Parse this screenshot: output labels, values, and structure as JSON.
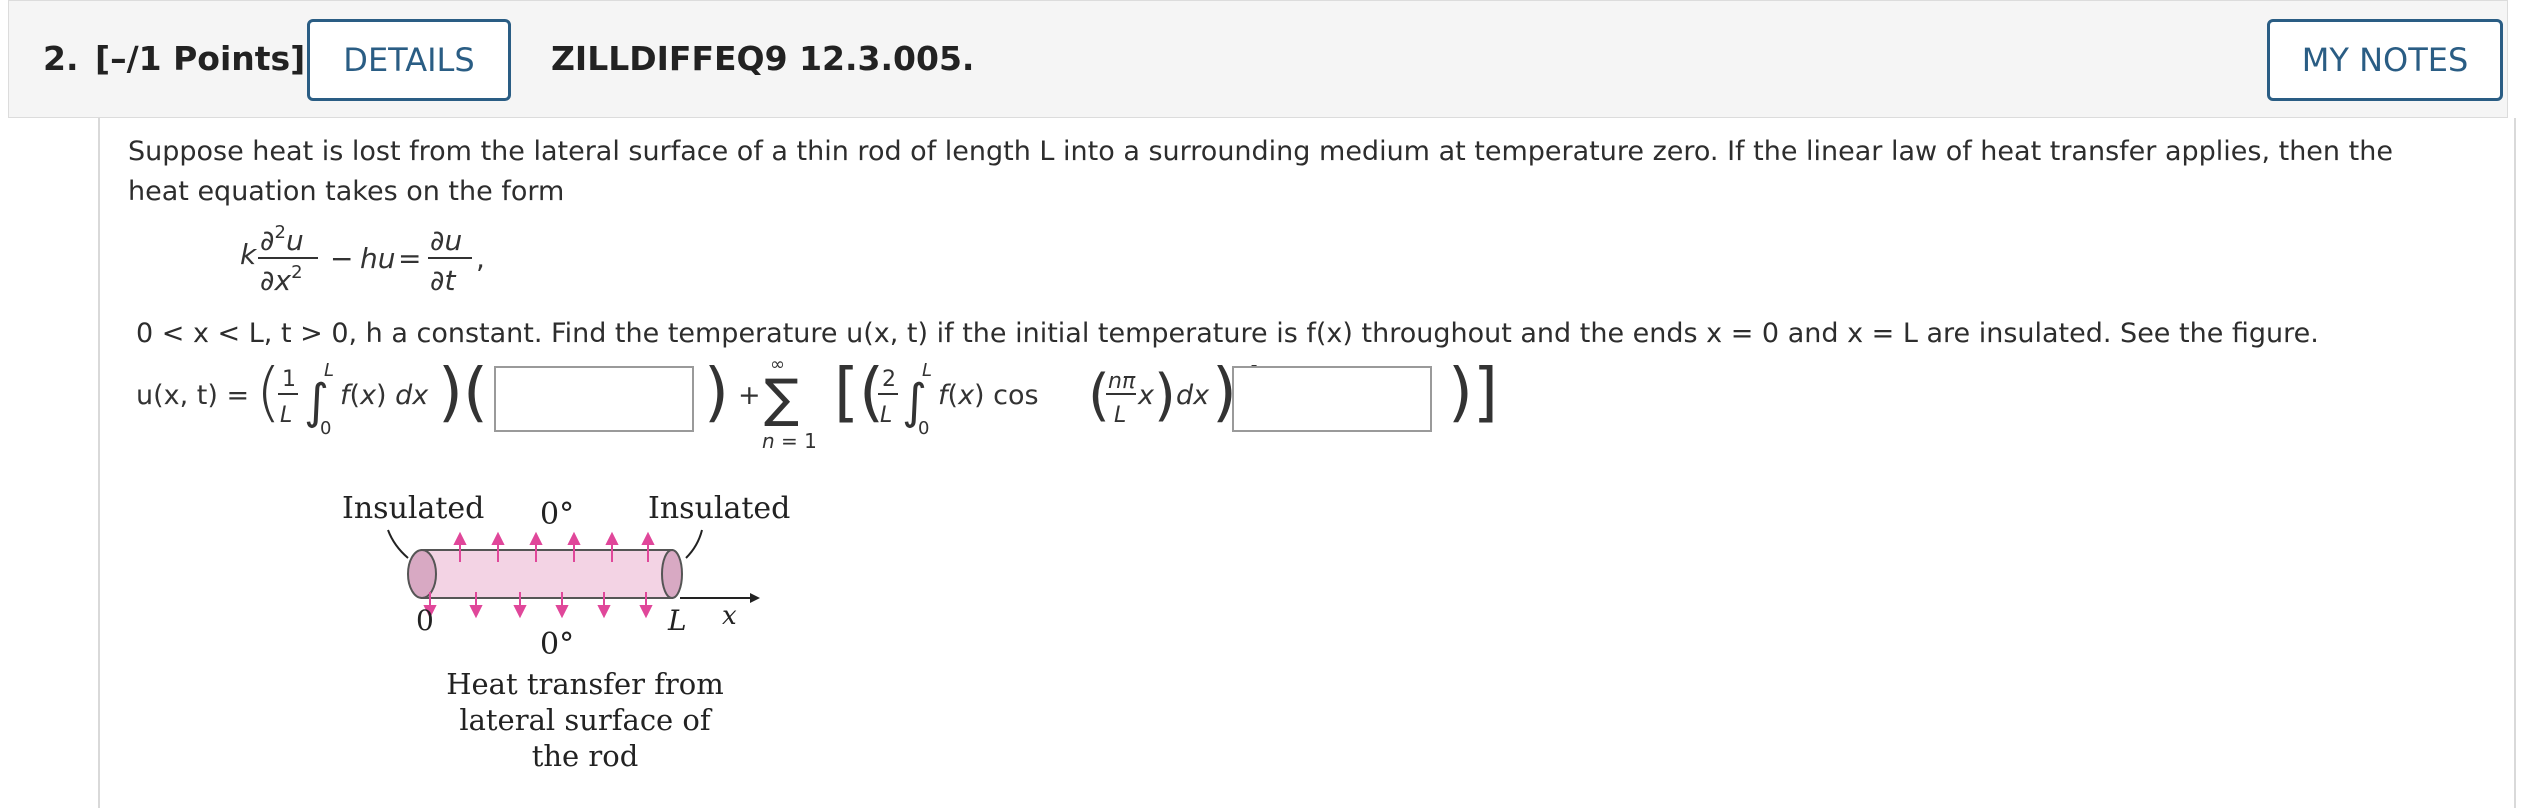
{
  "header": {
    "question_number": "2.",
    "points": "[–/1 Points]",
    "details_label": "DETAILS",
    "assignment_code": "ZILLDIFFEQ9 12.3.005.",
    "notes_label": "MY NOTES"
  },
  "problem": {
    "text": "Suppose heat is lost from the lateral surface of a thin rod of length L into a surrounding medium at temperature zero. If the linear law of heat transfer applies, then the heat equation takes on the form",
    "conditions": "0 < x < L, t > 0,  h a constant. Find the temperature  u(x, t)  if the initial temperature is f(x) throughout and the ends  x = 0  and  x = L  are insulated. See the figure."
  },
  "answer": {
    "lhs": "u(x, t) =",
    "blank1_value": "",
    "blank2_value": ""
  },
  "figure": {
    "left_label": "Insulated",
    "right_label": "Insulated",
    "top_temp": "0°",
    "bottom_temp": "0°",
    "origin_label": "0",
    "length_label": "L",
    "axis_label": "x",
    "caption_line1": "Heat transfer from",
    "caption_line2": "lateral surface of",
    "caption_line3": "the rod",
    "rod_color": "#f3d3e4",
    "arrow_color": "#e0479a"
  }
}
